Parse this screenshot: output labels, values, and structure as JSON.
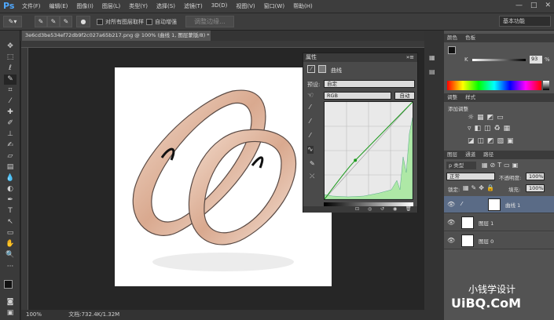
{
  "app": {
    "logo": "Ps"
  },
  "menu": [
    "文件(F)",
    "编辑(E)",
    "图像(I)",
    "图层(L)",
    "类型(Y)",
    "选择(S)",
    "滤镜(T)",
    "3D(D)",
    "视图(V)",
    "窗口(W)",
    "帮助(H)"
  ],
  "window_controls": {
    "minimize": "—",
    "maximize": "□",
    "close": "✕"
  },
  "options_bar": {
    "sample_all_layers": "对所有图层取样",
    "auto_enhance": "自动增强",
    "refine_edge": "调整边缘...",
    "workspace": "基本功能"
  },
  "document": {
    "tab_title": "3e6cd3be534ef72db9f2c027a65b217.png @ 100% (曲线 1, 图层蒙版/8) *",
    "zoom": "100%",
    "doc_size": "文档:732.4K/1.32M"
  },
  "properties": {
    "tab_label": "属性",
    "title": "曲线",
    "preset_label": "预设:",
    "preset_value": "自定",
    "channel_value": "RGB",
    "auto_button": "自动",
    "curve_point": {
      "input": 0.35,
      "output": 0.4
    }
  },
  "right_panels": {
    "color_tabs": [
      "颜色",
      "色板"
    ],
    "k_label": "K",
    "k_value": "93",
    "k_unit": "%",
    "adjust_tabs": [
      "调整",
      "样式"
    ],
    "add_adjustment": "添加调整",
    "layers_tabs": [
      "图层",
      "通道",
      "路径"
    ],
    "filter_label": "p 类型",
    "blend_mode": "正常",
    "opacity_label": "不透明度:",
    "opacity_value": "100%",
    "lock_label": "锁定:",
    "fill_label": "填充:",
    "fill_value": "100%",
    "layers": [
      {
        "name": "曲线 1",
        "selected": true
      },
      {
        "name": "图层 1",
        "selected": false
      },
      {
        "name": "图层 0",
        "selected": false
      }
    ]
  },
  "watermark": {
    "line1": "小钱学设计",
    "line2": "UiBQ.CoM"
  }
}
